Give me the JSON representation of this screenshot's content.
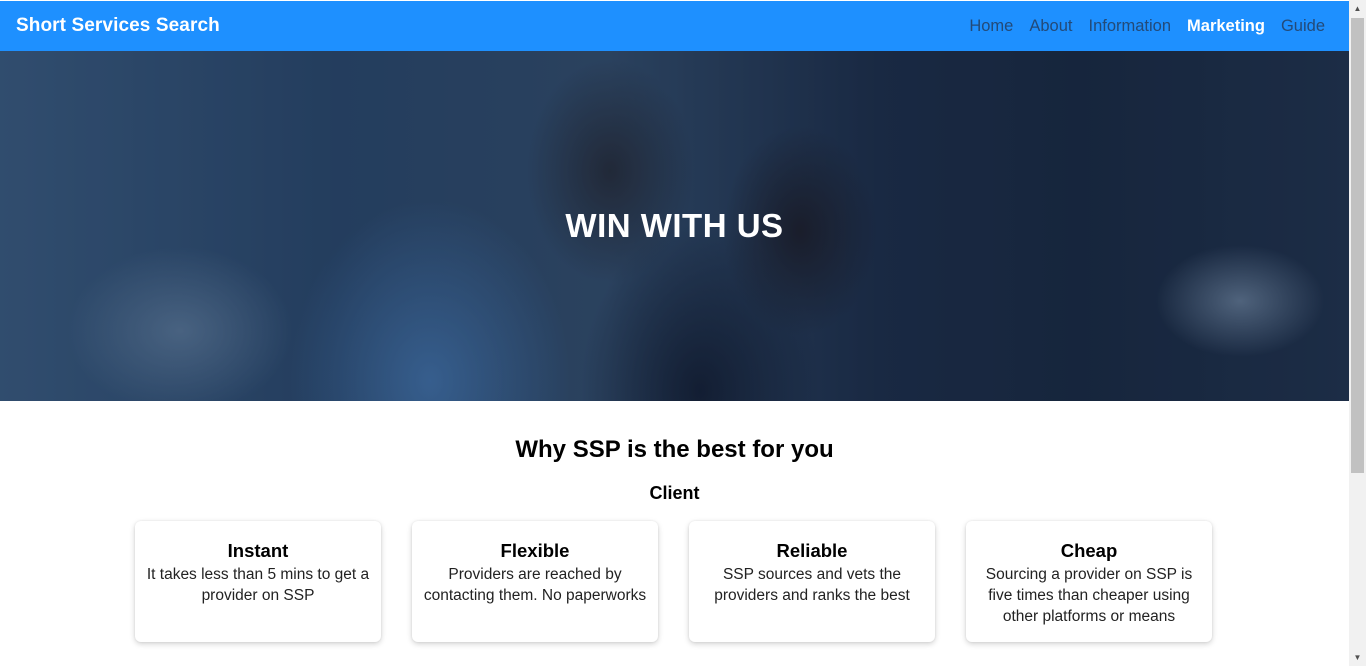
{
  "navbar": {
    "brand": "Short Services Search",
    "links": [
      {
        "label": "Home",
        "active": false
      },
      {
        "label": "About",
        "active": false
      },
      {
        "label": "Information",
        "active": false
      },
      {
        "label": "Marketing",
        "active": true
      },
      {
        "label": "Guide",
        "active": false
      }
    ]
  },
  "hero": {
    "title": "WIN WITH US"
  },
  "section": {
    "title": "Why SSP is the best for you",
    "subtitle": "Client"
  },
  "cards": [
    {
      "title": "Instant",
      "text": "It takes less than 5 mins to get a provider on SSP"
    },
    {
      "title": "Flexible",
      "text": "Providers are reached by contacting them. No paperworks"
    },
    {
      "title": "Reliable",
      "text": "SSP sources and vets the providers and ranks the best"
    },
    {
      "title": "Cheap",
      "text": "Sourcing a provider on SSP is five times than cheaper using other platforms or means"
    }
  ],
  "colors": {
    "navbar_bg": "#1e90ff",
    "nav_link": "#234a78",
    "nav_link_active": "#ffffff"
  },
  "icons": {
    "scroll_up": "triangle-up-icon",
    "scroll_down": "triangle-down-icon"
  }
}
